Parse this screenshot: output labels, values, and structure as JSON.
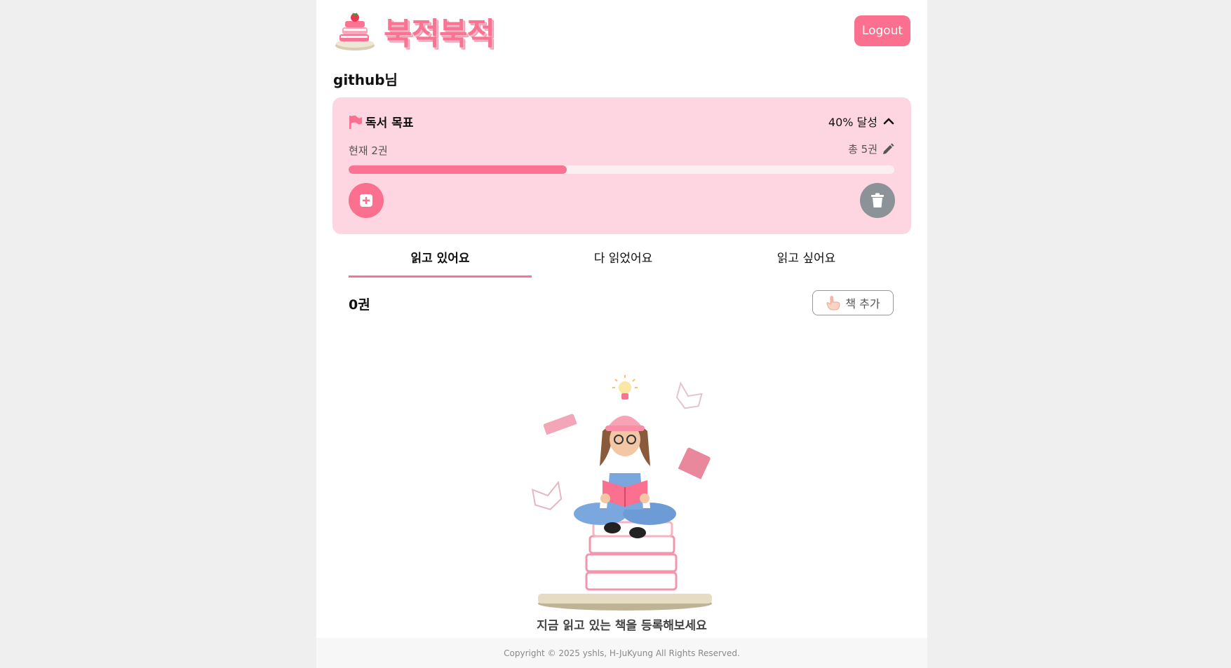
{
  "header": {
    "logo_text": "북적북적",
    "logout_label": "Logout"
  },
  "user": {
    "greeting": "github님"
  },
  "goal": {
    "title": "독서 목표",
    "status": "40% 달성",
    "current": "현재 2권",
    "total": "총 5권",
    "progress": 0.4
  },
  "tabs": [
    {
      "label": "읽고 있어요",
      "active": true
    },
    {
      "label": "다 읽었어요",
      "active": false
    },
    {
      "label": "읽고 싶어요",
      "active": false
    }
  ],
  "list": {
    "count": "0권",
    "add_book_label": "책 추가",
    "empty_message": "지금 읽고 있는 책을 등록해보세요"
  },
  "footer": {
    "copyright": "Copyright © 2025 yshls, H-JuKyung All Rights Reserved."
  },
  "colors": {
    "accent": "#fb7393",
    "card_bg": "#fdd6e1",
    "delete_btn": "#8c9398"
  }
}
